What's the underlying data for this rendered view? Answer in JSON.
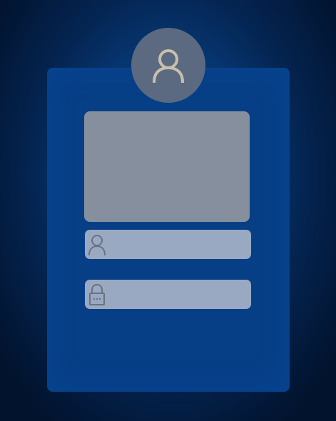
{
  "login": {
    "username": {
      "value": "",
      "placeholder": "",
      "icon": "user-icon"
    },
    "password": {
      "value": "",
      "placeholder": "",
      "icon": "lock-icon"
    },
    "avatar_icon": "user-avatar-icon"
  },
  "colors": {
    "background_center": "#0a4d9a",
    "background_edge": "#02132e",
    "panel": "#073f86",
    "avatar": "#5b6a80",
    "avatar_icon_stroke": "#c8bfae",
    "banner": "#858f9e",
    "field": "#9aa9c2",
    "field_icon_stroke": "#6a7282"
  }
}
